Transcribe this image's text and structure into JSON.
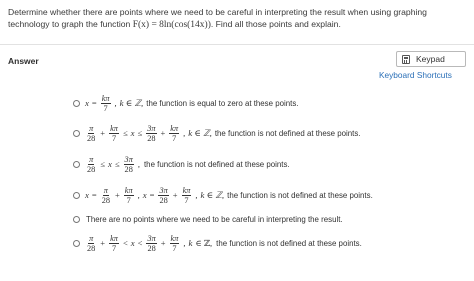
{
  "question": {
    "text_before": "Determine whether there are points where we need to be careful in interpreting the result when using graphing technology to graph the function ",
    "function_expr": "F(x) = 8ln(cos(14x))",
    "text_after": ". Find all those points and explain."
  },
  "answer_label": "Answer",
  "keypad": {
    "label": "Keypad",
    "icon": "keypad-icon"
  },
  "shortcuts_label": "Keyboard Shortcuts",
  "math": {
    "x": "x",
    "eq": "=",
    "plus": "+",
    "le": "≤",
    "lt": "<",
    "comma": ",",
    "k_in_z": "k ∈ ℤ,",
    "k": "k",
    "in_z": "∈ ℤ,",
    "kpi": "kπ",
    "pi": "π",
    "threepi": "3π",
    "seven": "7",
    "twentyeight": "28"
  },
  "options": [
    {
      "text": "the function is equal to zero at these points."
    },
    {
      "text": "the function is not defined at these points."
    },
    {
      "text": "the function is not defined at these points."
    },
    {
      "text": "the function is not defined at these points."
    },
    {
      "text": "There are no points where we need to be careful in interpreting the result."
    },
    {
      "text": "the function is not defined at these points."
    }
  ]
}
